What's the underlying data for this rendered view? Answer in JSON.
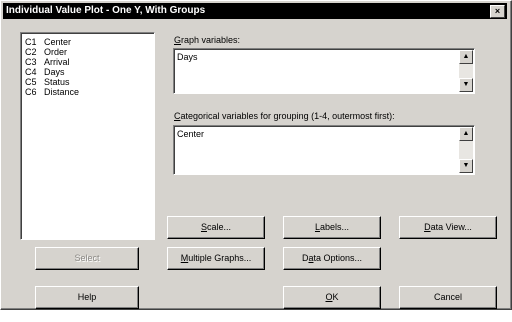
{
  "window": {
    "title": "Individual Value Plot - One Y, With Groups",
    "close_glyph": "×"
  },
  "variables": [
    {
      "code": "C1",
      "name": "Center"
    },
    {
      "code": "C2",
      "name": "Order"
    },
    {
      "code": "C3",
      "name": "Arrival"
    },
    {
      "code": "C4",
      "name": "Days"
    },
    {
      "code": "C5",
      "name": "Status"
    },
    {
      "code": "C6",
      "name": "Distance"
    }
  ],
  "graph_variables": {
    "label_mnemonic": "G",
    "label_rest": "raph variables:",
    "value": "Days"
  },
  "categorical_variables": {
    "label_mnemonic": "C",
    "label_rest": "ategorical variables for grouping (1-4, outermost first):",
    "value": "Center"
  },
  "scroll": {
    "up": "▲",
    "down": "▼"
  },
  "buttons": {
    "scale": {
      "mnemonic": "S",
      "rest": "cale..."
    },
    "labels": {
      "mnemonic": "L",
      "rest": "abels..."
    },
    "data_view": {
      "mnemonic": "D",
      "rest": "ata View..."
    },
    "select": "Select",
    "multiple_graphs": {
      "mnemonic": "M",
      "rest": "ultiple Graphs..."
    },
    "data_options": {
      "pre": "D",
      "mnemonic": "a",
      "rest": "ta Options..."
    },
    "help": "Help",
    "ok": {
      "mnemonic": "O",
      "rest": "K"
    },
    "cancel": "Cancel"
  }
}
